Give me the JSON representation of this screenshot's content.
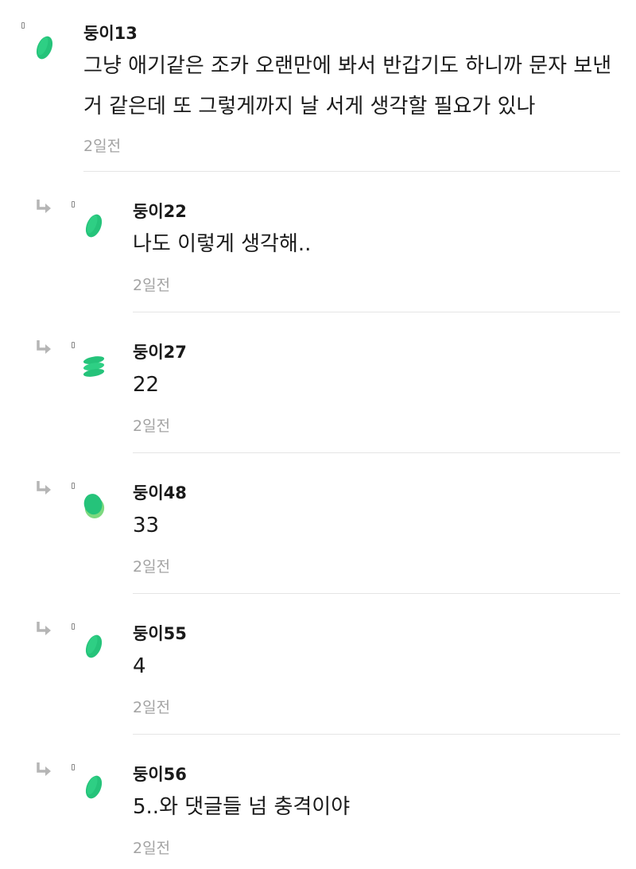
{
  "comments": [
    {
      "author": "둥이13",
      "text": "그냥 애기같은 조카 오랜만에 봐서 반갑기도 하니까 문자 보낸 거 같은데 또 그렇게까지 날 서게 생각할 필요가 있나",
      "time": "2일전",
      "is_reply": false,
      "avatar": "green-leaf-icon"
    },
    {
      "author": "둥이22",
      "text": "나도 이렇게 생각해..",
      "time": "2일전",
      "is_reply": true,
      "avatar": "green-leaf-icon"
    },
    {
      "author": "둥이27",
      "text": "22",
      "time": "2일전",
      "is_reply": true,
      "avatar": "green-stack-icon"
    },
    {
      "author": "둥이48",
      "text": "33",
      "time": "2일전",
      "is_reply": true,
      "avatar": "green-blob-icon"
    },
    {
      "author": "둥이55",
      "text": "4",
      "time": "2일전",
      "is_reply": true,
      "avatar": "green-leaf-icon"
    },
    {
      "author": "둥이56",
      "text": "5..와 댓글들 넘 충격이야",
      "time": "2일전",
      "is_reply": true,
      "avatar": "green-leaf-icon"
    }
  ],
  "colors": {
    "avatar_green": "#25c37a",
    "avatar_light_green": "#7dd97f",
    "time_gray": "#a3a3a3",
    "divider_gray": "#e5e5e5"
  }
}
